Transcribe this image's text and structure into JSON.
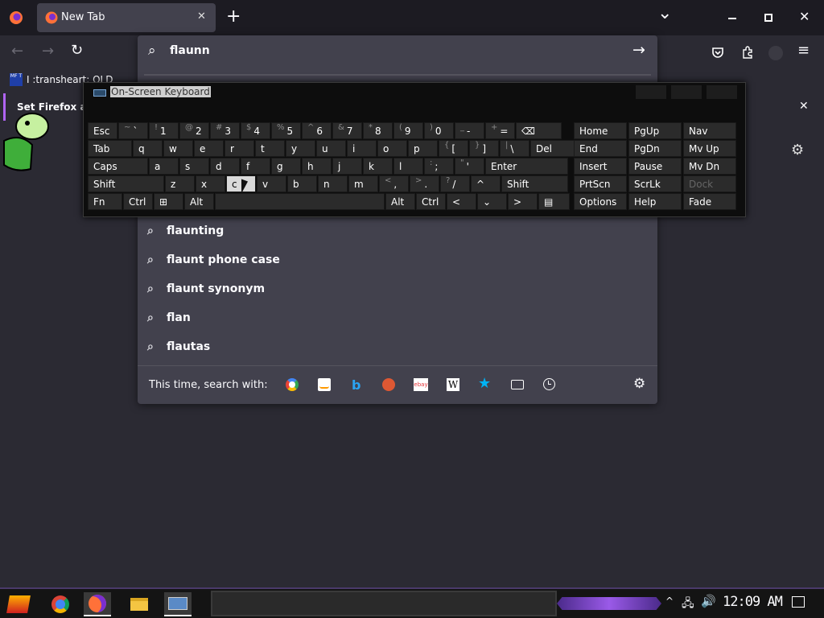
{
  "browser": {
    "tab_title": "New Tab",
    "new_tab_glyph": "+",
    "list_tabs_glyph": "⌄",
    "bookmark_label": "I :transheart: OLD",
    "bookmark_badge": "MF T",
    "infobar_text": "Set Firefox a",
    "close_glyph": "✕"
  },
  "search": {
    "query": "flaunn",
    "suggestions": [
      "flaunting",
      "flaunt phone case",
      "flaunt synonym",
      "flan",
      "flautas"
    ],
    "engines_label": "This time, search with:",
    "engines": [
      "google-icon",
      "amazon-icon",
      "bing-icon",
      "duckduckgo-icon",
      "ebay-icon",
      "wikipedia-icon",
      "bookmarks-icon",
      "tabs-icon",
      "history-icon"
    ]
  },
  "osk": {
    "title": "On-Screen Keyboard",
    "rows": [
      [
        {
          "l": "Esc"
        },
        {
          "s": "~",
          "l": "`"
        },
        {
          "s": "!",
          "l": "1"
        },
        {
          "s": "@",
          "l": "2"
        },
        {
          "s": "#",
          "l": "3"
        },
        {
          "s": "$",
          "l": "4"
        },
        {
          "s": "%",
          "l": "5"
        },
        {
          "s": "^",
          "l": "6"
        },
        {
          "s": "&",
          "l": "7"
        },
        {
          "s": "*",
          "l": "8"
        },
        {
          "s": "(",
          "l": "9"
        },
        {
          "s": ")",
          "l": "0"
        },
        {
          "s": "_",
          "l": "-"
        },
        {
          "s": "+",
          "l": "="
        },
        {
          "l": "⌫"
        }
      ],
      [
        {
          "l": "Tab"
        },
        {
          "l": "q"
        },
        {
          "l": "w"
        },
        {
          "l": "e"
        },
        {
          "l": "r"
        },
        {
          "l": "t"
        },
        {
          "l": "y"
        },
        {
          "l": "u"
        },
        {
          "l": "i"
        },
        {
          "l": "o"
        },
        {
          "l": "p"
        },
        {
          "s": "{",
          "l": "["
        },
        {
          "s": "}",
          "l": "]"
        },
        {
          "s": "|",
          "l": "\\"
        },
        {
          "l": "Del"
        }
      ],
      [
        {
          "l": "Caps"
        },
        {
          "l": "a"
        },
        {
          "l": "s"
        },
        {
          "l": "d"
        },
        {
          "l": "f"
        },
        {
          "l": "g"
        },
        {
          "l": "h"
        },
        {
          "l": "j"
        },
        {
          "l": "k"
        },
        {
          "l": "l"
        },
        {
          "s": ":",
          "l": ";"
        },
        {
          "s": "\"",
          "l": "'"
        },
        {
          "l": "Enter"
        }
      ],
      [
        {
          "l": "Shift"
        },
        {
          "l": "z"
        },
        {
          "l": "x"
        },
        {
          "l": "c"
        },
        {
          "l": "v"
        },
        {
          "l": "b"
        },
        {
          "l": "n"
        },
        {
          "l": "m"
        },
        {
          "s": "<",
          "l": ","
        },
        {
          "s": ">",
          "l": "."
        },
        {
          "s": "?",
          "l": "/"
        },
        {
          "l": "^"
        },
        {
          "l": "Shift"
        }
      ],
      [
        {
          "l": "Fn"
        },
        {
          "l": "Ctrl"
        },
        {
          "l": "⊞"
        },
        {
          "l": "Alt"
        },
        {
          "l": ""
        },
        {
          "l": "Alt"
        },
        {
          "l": "Ctrl"
        },
        {
          "l": "<"
        },
        {
          "l": "⌄"
        },
        {
          "l": ">"
        },
        {
          "l": "▤"
        }
      ]
    ],
    "nav_keys": [
      [
        "Home",
        "PgUp",
        "Nav"
      ],
      [
        "End",
        "PgDn",
        "Mv Up"
      ],
      [
        "Insert",
        "Pause",
        "Mv Dn"
      ],
      [
        "PrtScn",
        "ScrLk",
        "Dock"
      ],
      [
        "Options",
        "Help",
        "Fade"
      ]
    ]
  },
  "taskbar": {
    "clock": "12:09 AM"
  },
  "colors": {
    "accent": "#b064f4",
    "panel": "#42414d",
    "bg": "#2b2a33"
  }
}
